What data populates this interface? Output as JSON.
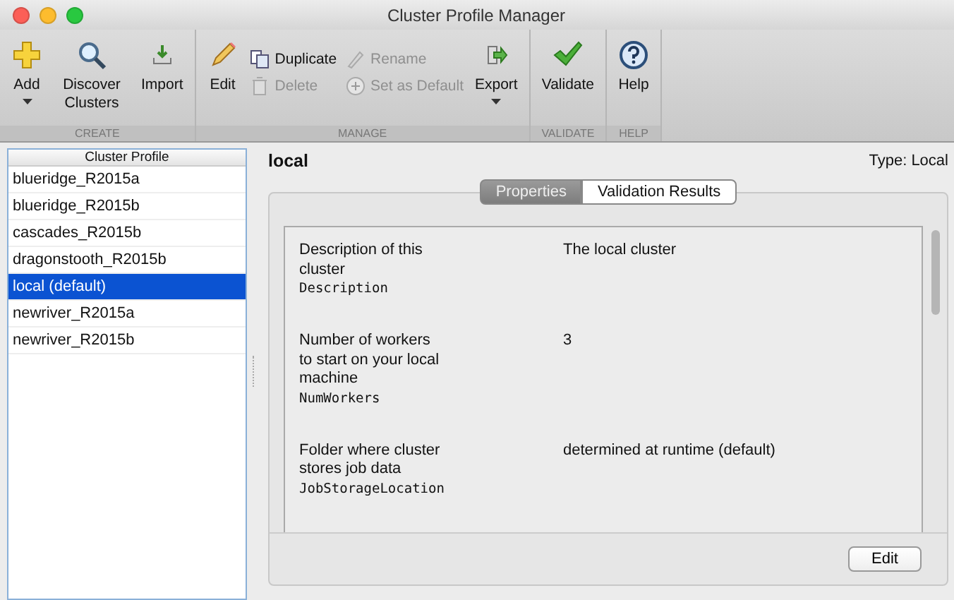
{
  "window": {
    "title": "Cluster Profile Manager"
  },
  "toolbar": {
    "groups": [
      {
        "label": "CREATE",
        "items": [
          {
            "kind": "big",
            "label": "Add",
            "dropdown": true
          },
          {
            "kind": "big",
            "label": "Discover Clusters",
            "dropdown": false
          },
          {
            "kind": "big",
            "label": "Import",
            "dropdown": false
          }
        ]
      },
      {
        "label": "MANAGE",
        "items": [
          {
            "kind": "big",
            "label": "Edit",
            "dropdown": false
          },
          {
            "kind": "stack",
            "items": [
              {
                "label": "Duplicate",
                "disabled": false
              },
              {
                "label": "Delete",
                "disabled": true
              }
            ]
          },
          {
            "kind": "stack",
            "items": [
              {
                "label": "Rename",
                "disabled": true
              },
              {
                "label": "Set as Default",
                "disabled": true
              }
            ]
          },
          {
            "kind": "big",
            "label": "Export",
            "dropdown": true
          }
        ]
      },
      {
        "label": "VALIDATE",
        "items": [
          {
            "kind": "big",
            "label": "Validate",
            "dropdown": false
          }
        ]
      },
      {
        "label": "HELP",
        "items": [
          {
            "kind": "big",
            "label": "Help",
            "dropdown": false
          }
        ]
      }
    ]
  },
  "profiles": {
    "header": "Cluster Profile",
    "rows": [
      {
        "label": "blueridge_R2015a",
        "selected": false
      },
      {
        "label": "blueridge_R2015b",
        "selected": false
      },
      {
        "label": "cascades_R2015b",
        "selected": false
      },
      {
        "label": "dragonstooth_R2015b",
        "selected": false
      },
      {
        "label": "local (default)",
        "selected": true
      },
      {
        "label": "newriver_R2015a",
        "selected": false
      },
      {
        "label": "newriver_R2015b",
        "selected": false
      }
    ]
  },
  "detail": {
    "name": "local",
    "type": "Type: Local",
    "tabs": [
      {
        "label": "Properties",
        "selected": true
      },
      {
        "label": "Validation Results",
        "selected": false
      }
    ],
    "properties": [
      {
        "label": "Description of this cluster",
        "key": "Description",
        "value": "The local cluster"
      },
      {
        "label": "Number of workers to start on your local machine",
        "key": "NumWorkers",
        "value": "3"
      },
      {
        "label": "Folder where cluster stores job data",
        "key": "JobStorageLocation",
        "value": "determined at runtime (default)"
      }
    ],
    "edit_button": "Edit"
  }
}
